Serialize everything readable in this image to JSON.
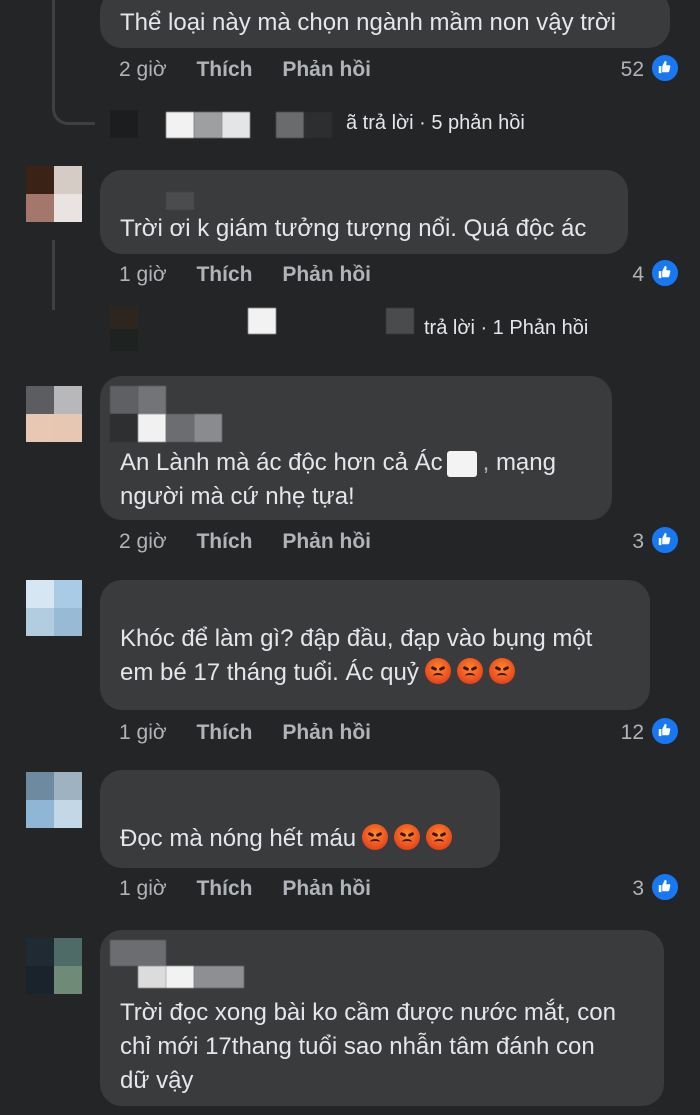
{
  "comments": [
    {
      "text": "Thể loại này mà chọn ngành mầm non vậy trời",
      "time": "2 giờ",
      "like_label": "Thích",
      "reply_label": "Phản hồi",
      "likes": "52",
      "replies_summary": "ã trả lời · 5 phản hồi"
    },
    {
      "text": "Trời ơi k giám tưởng tượng nổi. Quá độc ác",
      "time": "1 giờ",
      "like_label": "Thích",
      "reply_label": "Phản hồi",
      "likes": "4",
      "replies_summary": "trả lời · 1 Phản hồi"
    },
    {
      "text_line1_a": "An Lành mà ác độc hơn cả Ác",
      "text_line1_b": "mạng",
      "text_line2": "người mà cứ nhẹ tựa!",
      "time": "2 giờ",
      "like_label": "Thích",
      "reply_label": "Phản hồi",
      "likes": "3"
    },
    {
      "text_line1": "Khóc để làm gì? đập đầu, đạp vào bụng một",
      "text_line2": "em bé 17 tháng tuổi. Ác quỷ",
      "time": "1 giờ",
      "like_label": "Thích",
      "reply_label": "Phản hồi",
      "likes": "12"
    },
    {
      "text": "Đọc mà nóng hết máu",
      "time": "1 giờ",
      "like_label": "Thích",
      "reply_label": "Phản hồi",
      "likes": "3"
    },
    {
      "text_line1": "Trời đọc xong bài ko cầm được nước mắt, con",
      "text_line2": "chỉ mới 17thang tuổi sao nhẫn tâm đánh con",
      "text_line3": "dữ vậy"
    }
  ],
  "icons": {
    "like": "thumbs-up-icon",
    "angry": "angry-face-emoji"
  },
  "colors": {
    "background": "#242526",
    "bubble": "#3a3b3c",
    "like_blue": "#1877f2",
    "meta_text": "#b0b3b8"
  }
}
